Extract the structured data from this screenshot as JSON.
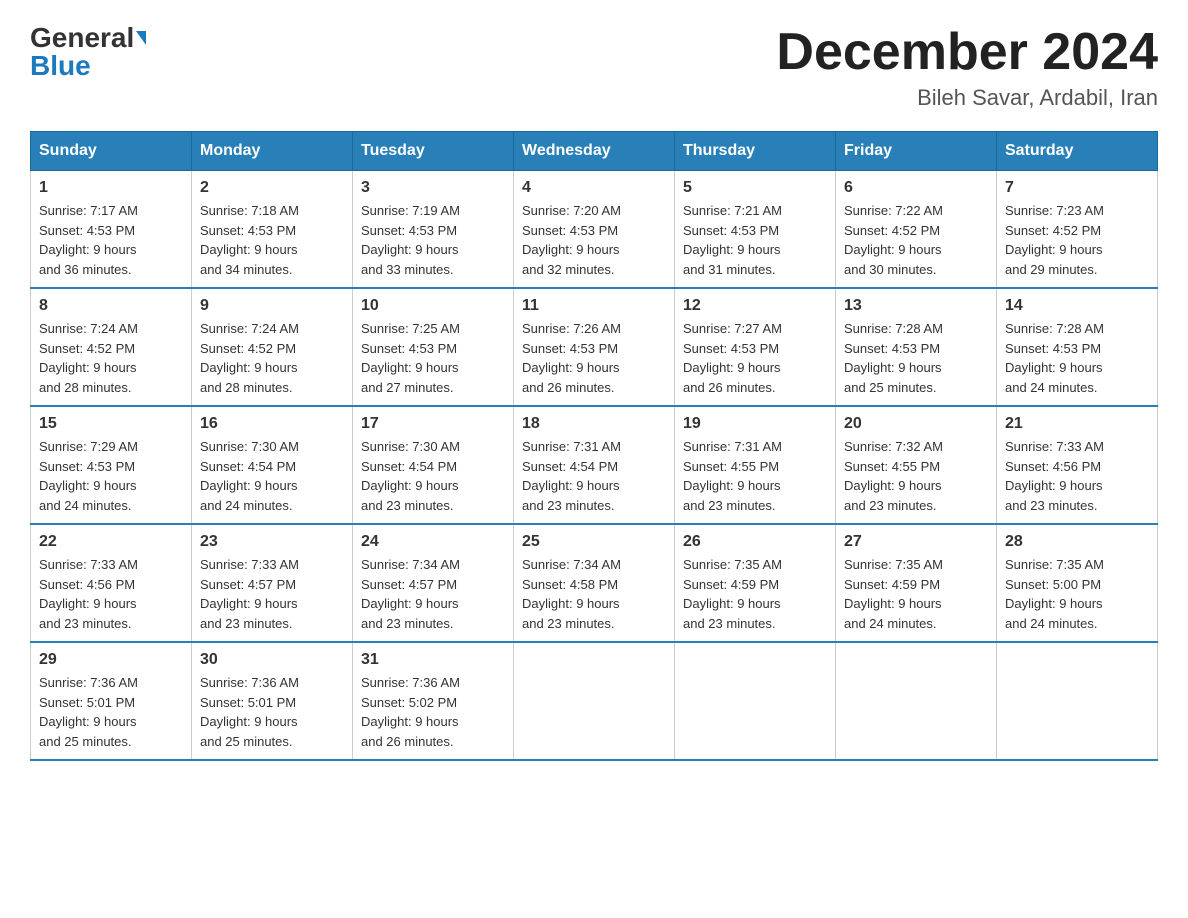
{
  "header": {
    "logo_general": "General",
    "logo_blue": "Blue",
    "month_title": "December 2024",
    "location": "Bileh Savar, Ardabil, Iran"
  },
  "weekdays": [
    "Sunday",
    "Monday",
    "Tuesday",
    "Wednesday",
    "Thursday",
    "Friday",
    "Saturday"
  ],
  "weeks": [
    [
      {
        "day": "1",
        "sunrise": "7:17 AM",
        "sunset": "4:53 PM",
        "daylight": "9 hours and 36 minutes."
      },
      {
        "day": "2",
        "sunrise": "7:18 AM",
        "sunset": "4:53 PM",
        "daylight": "9 hours and 34 minutes."
      },
      {
        "day": "3",
        "sunrise": "7:19 AM",
        "sunset": "4:53 PM",
        "daylight": "9 hours and 33 minutes."
      },
      {
        "day": "4",
        "sunrise": "7:20 AM",
        "sunset": "4:53 PM",
        "daylight": "9 hours and 32 minutes."
      },
      {
        "day": "5",
        "sunrise": "7:21 AM",
        "sunset": "4:53 PM",
        "daylight": "9 hours and 31 minutes."
      },
      {
        "day": "6",
        "sunrise": "7:22 AM",
        "sunset": "4:52 PM",
        "daylight": "9 hours and 30 minutes."
      },
      {
        "day": "7",
        "sunrise": "7:23 AM",
        "sunset": "4:52 PM",
        "daylight": "9 hours and 29 minutes."
      }
    ],
    [
      {
        "day": "8",
        "sunrise": "7:24 AM",
        "sunset": "4:52 PM",
        "daylight": "9 hours and 28 minutes."
      },
      {
        "day": "9",
        "sunrise": "7:24 AM",
        "sunset": "4:52 PM",
        "daylight": "9 hours and 28 minutes."
      },
      {
        "day": "10",
        "sunrise": "7:25 AM",
        "sunset": "4:53 PM",
        "daylight": "9 hours and 27 minutes."
      },
      {
        "day": "11",
        "sunrise": "7:26 AM",
        "sunset": "4:53 PM",
        "daylight": "9 hours and 26 minutes."
      },
      {
        "day": "12",
        "sunrise": "7:27 AM",
        "sunset": "4:53 PM",
        "daylight": "9 hours and 26 minutes."
      },
      {
        "day": "13",
        "sunrise": "7:28 AM",
        "sunset": "4:53 PM",
        "daylight": "9 hours and 25 minutes."
      },
      {
        "day": "14",
        "sunrise": "7:28 AM",
        "sunset": "4:53 PM",
        "daylight": "9 hours and 24 minutes."
      }
    ],
    [
      {
        "day": "15",
        "sunrise": "7:29 AM",
        "sunset": "4:53 PM",
        "daylight": "9 hours and 24 minutes."
      },
      {
        "day": "16",
        "sunrise": "7:30 AM",
        "sunset": "4:54 PM",
        "daylight": "9 hours and 24 minutes."
      },
      {
        "day": "17",
        "sunrise": "7:30 AM",
        "sunset": "4:54 PM",
        "daylight": "9 hours and 23 minutes."
      },
      {
        "day": "18",
        "sunrise": "7:31 AM",
        "sunset": "4:54 PM",
        "daylight": "9 hours and 23 minutes."
      },
      {
        "day": "19",
        "sunrise": "7:31 AM",
        "sunset": "4:55 PM",
        "daylight": "9 hours and 23 minutes."
      },
      {
        "day": "20",
        "sunrise": "7:32 AM",
        "sunset": "4:55 PM",
        "daylight": "9 hours and 23 minutes."
      },
      {
        "day": "21",
        "sunrise": "7:33 AM",
        "sunset": "4:56 PM",
        "daylight": "9 hours and 23 minutes."
      }
    ],
    [
      {
        "day": "22",
        "sunrise": "7:33 AM",
        "sunset": "4:56 PM",
        "daylight": "9 hours and 23 minutes."
      },
      {
        "day": "23",
        "sunrise": "7:33 AM",
        "sunset": "4:57 PM",
        "daylight": "9 hours and 23 minutes."
      },
      {
        "day": "24",
        "sunrise": "7:34 AM",
        "sunset": "4:57 PM",
        "daylight": "9 hours and 23 minutes."
      },
      {
        "day": "25",
        "sunrise": "7:34 AM",
        "sunset": "4:58 PM",
        "daylight": "9 hours and 23 minutes."
      },
      {
        "day": "26",
        "sunrise": "7:35 AM",
        "sunset": "4:59 PM",
        "daylight": "9 hours and 23 minutes."
      },
      {
        "day": "27",
        "sunrise": "7:35 AM",
        "sunset": "4:59 PM",
        "daylight": "9 hours and 24 minutes."
      },
      {
        "day": "28",
        "sunrise": "7:35 AM",
        "sunset": "5:00 PM",
        "daylight": "9 hours and 24 minutes."
      }
    ],
    [
      {
        "day": "29",
        "sunrise": "7:36 AM",
        "sunset": "5:01 PM",
        "daylight": "9 hours and 25 minutes."
      },
      {
        "day": "30",
        "sunrise": "7:36 AM",
        "sunset": "5:01 PM",
        "daylight": "9 hours and 25 minutes."
      },
      {
        "day": "31",
        "sunrise": "7:36 AM",
        "sunset": "5:02 PM",
        "daylight": "9 hours and 26 minutes."
      },
      null,
      null,
      null,
      null
    ]
  ],
  "labels": {
    "sunrise": "Sunrise:",
    "sunset": "Sunset:",
    "daylight": "Daylight:"
  }
}
